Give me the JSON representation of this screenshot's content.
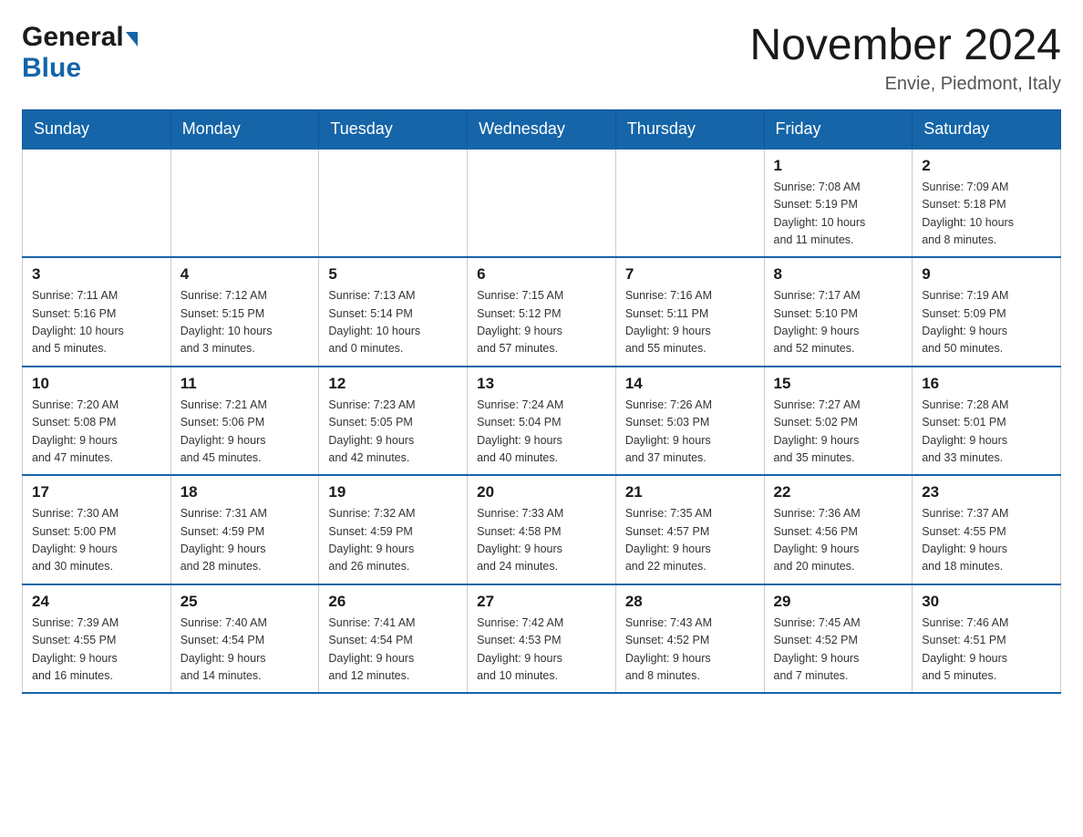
{
  "header": {
    "logo_general": "General",
    "logo_blue": "Blue",
    "month_title": "November 2024",
    "location": "Envie, Piedmont, Italy"
  },
  "days_of_week": [
    "Sunday",
    "Monday",
    "Tuesday",
    "Wednesday",
    "Thursday",
    "Friday",
    "Saturday"
  ],
  "weeks": [
    [
      {
        "day": "",
        "info": ""
      },
      {
        "day": "",
        "info": ""
      },
      {
        "day": "",
        "info": ""
      },
      {
        "day": "",
        "info": ""
      },
      {
        "day": "",
        "info": ""
      },
      {
        "day": "1",
        "info": "Sunrise: 7:08 AM\nSunset: 5:19 PM\nDaylight: 10 hours\nand 11 minutes."
      },
      {
        "day": "2",
        "info": "Sunrise: 7:09 AM\nSunset: 5:18 PM\nDaylight: 10 hours\nand 8 minutes."
      }
    ],
    [
      {
        "day": "3",
        "info": "Sunrise: 7:11 AM\nSunset: 5:16 PM\nDaylight: 10 hours\nand 5 minutes."
      },
      {
        "day": "4",
        "info": "Sunrise: 7:12 AM\nSunset: 5:15 PM\nDaylight: 10 hours\nand 3 minutes."
      },
      {
        "day": "5",
        "info": "Sunrise: 7:13 AM\nSunset: 5:14 PM\nDaylight: 10 hours\nand 0 minutes."
      },
      {
        "day": "6",
        "info": "Sunrise: 7:15 AM\nSunset: 5:12 PM\nDaylight: 9 hours\nand 57 minutes."
      },
      {
        "day": "7",
        "info": "Sunrise: 7:16 AM\nSunset: 5:11 PM\nDaylight: 9 hours\nand 55 minutes."
      },
      {
        "day": "8",
        "info": "Sunrise: 7:17 AM\nSunset: 5:10 PM\nDaylight: 9 hours\nand 52 minutes."
      },
      {
        "day": "9",
        "info": "Sunrise: 7:19 AM\nSunset: 5:09 PM\nDaylight: 9 hours\nand 50 minutes."
      }
    ],
    [
      {
        "day": "10",
        "info": "Sunrise: 7:20 AM\nSunset: 5:08 PM\nDaylight: 9 hours\nand 47 minutes."
      },
      {
        "day": "11",
        "info": "Sunrise: 7:21 AM\nSunset: 5:06 PM\nDaylight: 9 hours\nand 45 minutes."
      },
      {
        "day": "12",
        "info": "Sunrise: 7:23 AM\nSunset: 5:05 PM\nDaylight: 9 hours\nand 42 minutes."
      },
      {
        "day": "13",
        "info": "Sunrise: 7:24 AM\nSunset: 5:04 PM\nDaylight: 9 hours\nand 40 minutes."
      },
      {
        "day": "14",
        "info": "Sunrise: 7:26 AM\nSunset: 5:03 PM\nDaylight: 9 hours\nand 37 minutes."
      },
      {
        "day": "15",
        "info": "Sunrise: 7:27 AM\nSunset: 5:02 PM\nDaylight: 9 hours\nand 35 minutes."
      },
      {
        "day": "16",
        "info": "Sunrise: 7:28 AM\nSunset: 5:01 PM\nDaylight: 9 hours\nand 33 minutes."
      }
    ],
    [
      {
        "day": "17",
        "info": "Sunrise: 7:30 AM\nSunset: 5:00 PM\nDaylight: 9 hours\nand 30 minutes."
      },
      {
        "day": "18",
        "info": "Sunrise: 7:31 AM\nSunset: 4:59 PM\nDaylight: 9 hours\nand 28 minutes."
      },
      {
        "day": "19",
        "info": "Sunrise: 7:32 AM\nSunset: 4:59 PM\nDaylight: 9 hours\nand 26 minutes."
      },
      {
        "day": "20",
        "info": "Sunrise: 7:33 AM\nSunset: 4:58 PM\nDaylight: 9 hours\nand 24 minutes."
      },
      {
        "day": "21",
        "info": "Sunrise: 7:35 AM\nSunset: 4:57 PM\nDaylight: 9 hours\nand 22 minutes."
      },
      {
        "day": "22",
        "info": "Sunrise: 7:36 AM\nSunset: 4:56 PM\nDaylight: 9 hours\nand 20 minutes."
      },
      {
        "day": "23",
        "info": "Sunrise: 7:37 AM\nSunset: 4:55 PM\nDaylight: 9 hours\nand 18 minutes."
      }
    ],
    [
      {
        "day": "24",
        "info": "Sunrise: 7:39 AM\nSunset: 4:55 PM\nDaylight: 9 hours\nand 16 minutes."
      },
      {
        "day": "25",
        "info": "Sunrise: 7:40 AM\nSunset: 4:54 PM\nDaylight: 9 hours\nand 14 minutes."
      },
      {
        "day": "26",
        "info": "Sunrise: 7:41 AM\nSunset: 4:54 PM\nDaylight: 9 hours\nand 12 minutes."
      },
      {
        "day": "27",
        "info": "Sunrise: 7:42 AM\nSunset: 4:53 PM\nDaylight: 9 hours\nand 10 minutes."
      },
      {
        "day": "28",
        "info": "Sunrise: 7:43 AM\nSunset: 4:52 PM\nDaylight: 9 hours\nand 8 minutes."
      },
      {
        "day": "29",
        "info": "Sunrise: 7:45 AM\nSunset: 4:52 PM\nDaylight: 9 hours\nand 7 minutes."
      },
      {
        "day": "30",
        "info": "Sunrise: 7:46 AM\nSunset: 4:51 PM\nDaylight: 9 hours\nand 5 minutes."
      }
    ]
  ]
}
